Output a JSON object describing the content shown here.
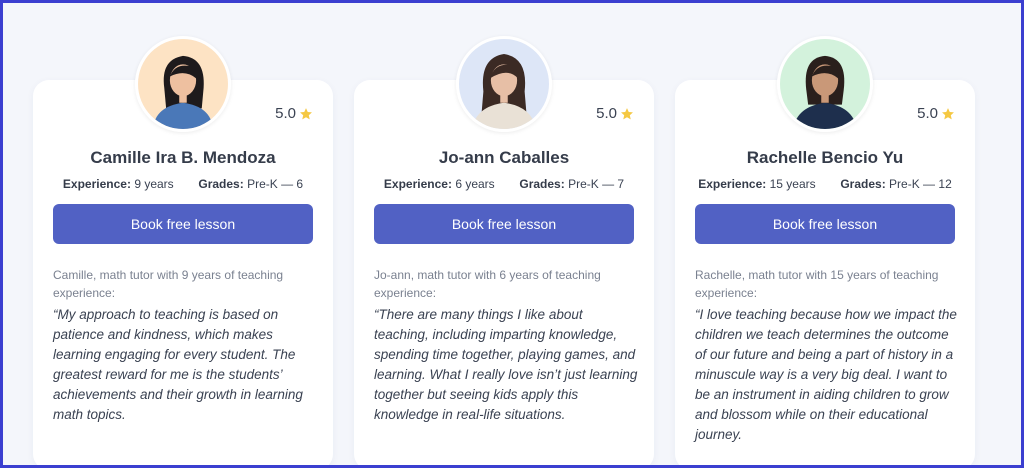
{
  "accent_color": "#5161c4",
  "star_color": "#f5c842",
  "tutors": [
    {
      "name": "Camille Ira B. Mendoza",
      "rating": "5.0",
      "experience_label": "Experience:",
      "experience": "9 years",
      "grades_label": "Grades:",
      "grades": "Pre-K — 6",
      "button_label": "Book free lesson",
      "intro": "Camille, math tutor with 9 years of teaching experience:",
      "quote": "“My approach to teaching is based on patience and kindness, which makes learning engaging for every student. The greatest reward for me is the students’ achievements and their growth in learning math topics.",
      "avatar_bg": "#fde3c4"
    },
    {
      "name": "Jo-ann Caballes",
      "rating": "5.0",
      "experience_label": "Experience:",
      "experience": "6 years",
      "grades_label": "Grades:",
      "grades": "Pre-K — 7",
      "button_label": "Book free lesson",
      "intro": "Jo-ann, math tutor with 6 years of teaching experience:",
      "quote": "“There are many things I like about teaching, including imparting knowledge, spending time together, playing games, and learning. What I really love isn’t just learning together but seeing kids apply this knowledge in real-life situations.",
      "avatar_bg": "#dde6f7"
    },
    {
      "name": "Rachelle Bencio Yu",
      "rating": "5.0",
      "experience_label": "Experience:",
      "experience": "15 years",
      "grades_label": "Grades:",
      "grades": "Pre-K — 12",
      "button_label": "Book free lesson",
      "intro": "Rachelle, math tutor with 15 years of teaching experience:",
      "quote": "“I love teaching because how we impact the children we teach determines the outcome of our future and being a part of history in a minuscule way is a very big deal. I want to be an instrument in aiding children to grow and blossom while on their educational journey.",
      "avatar_bg": "#d3f2dc"
    }
  ]
}
